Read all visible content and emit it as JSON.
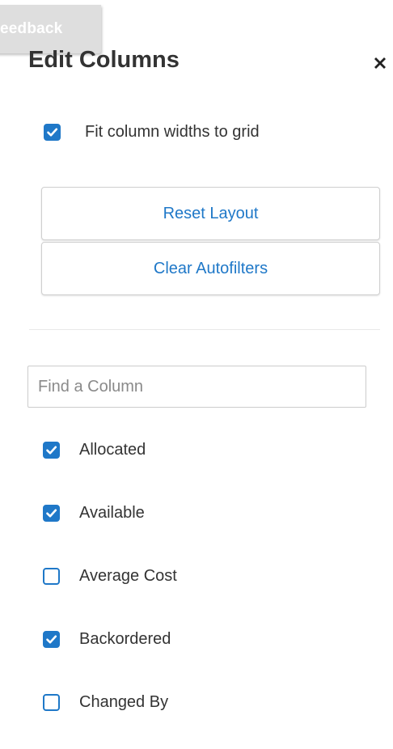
{
  "feedback": {
    "label": "eedback"
  },
  "panel": {
    "title": "Edit Columns",
    "close_icon": "close-icon"
  },
  "fit_columns": {
    "label": "Fit column widths to grid",
    "checked": true
  },
  "actions": {
    "reset_label": "Reset Layout",
    "clear_label": "Clear Autofilters"
  },
  "search": {
    "placeholder": "Find a Column",
    "value": ""
  },
  "columns": [
    {
      "label": "Allocated",
      "checked": true
    },
    {
      "label": "Available",
      "checked": true
    },
    {
      "label": "Average Cost",
      "checked": false
    },
    {
      "label": "Backordered",
      "checked": true
    },
    {
      "label": "Changed By",
      "checked": false
    }
  ],
  "colors": {
    "accent": "#1f78c8",
    "text": "#333333",
    "feedback_bg": "#dedede"
  }
}
